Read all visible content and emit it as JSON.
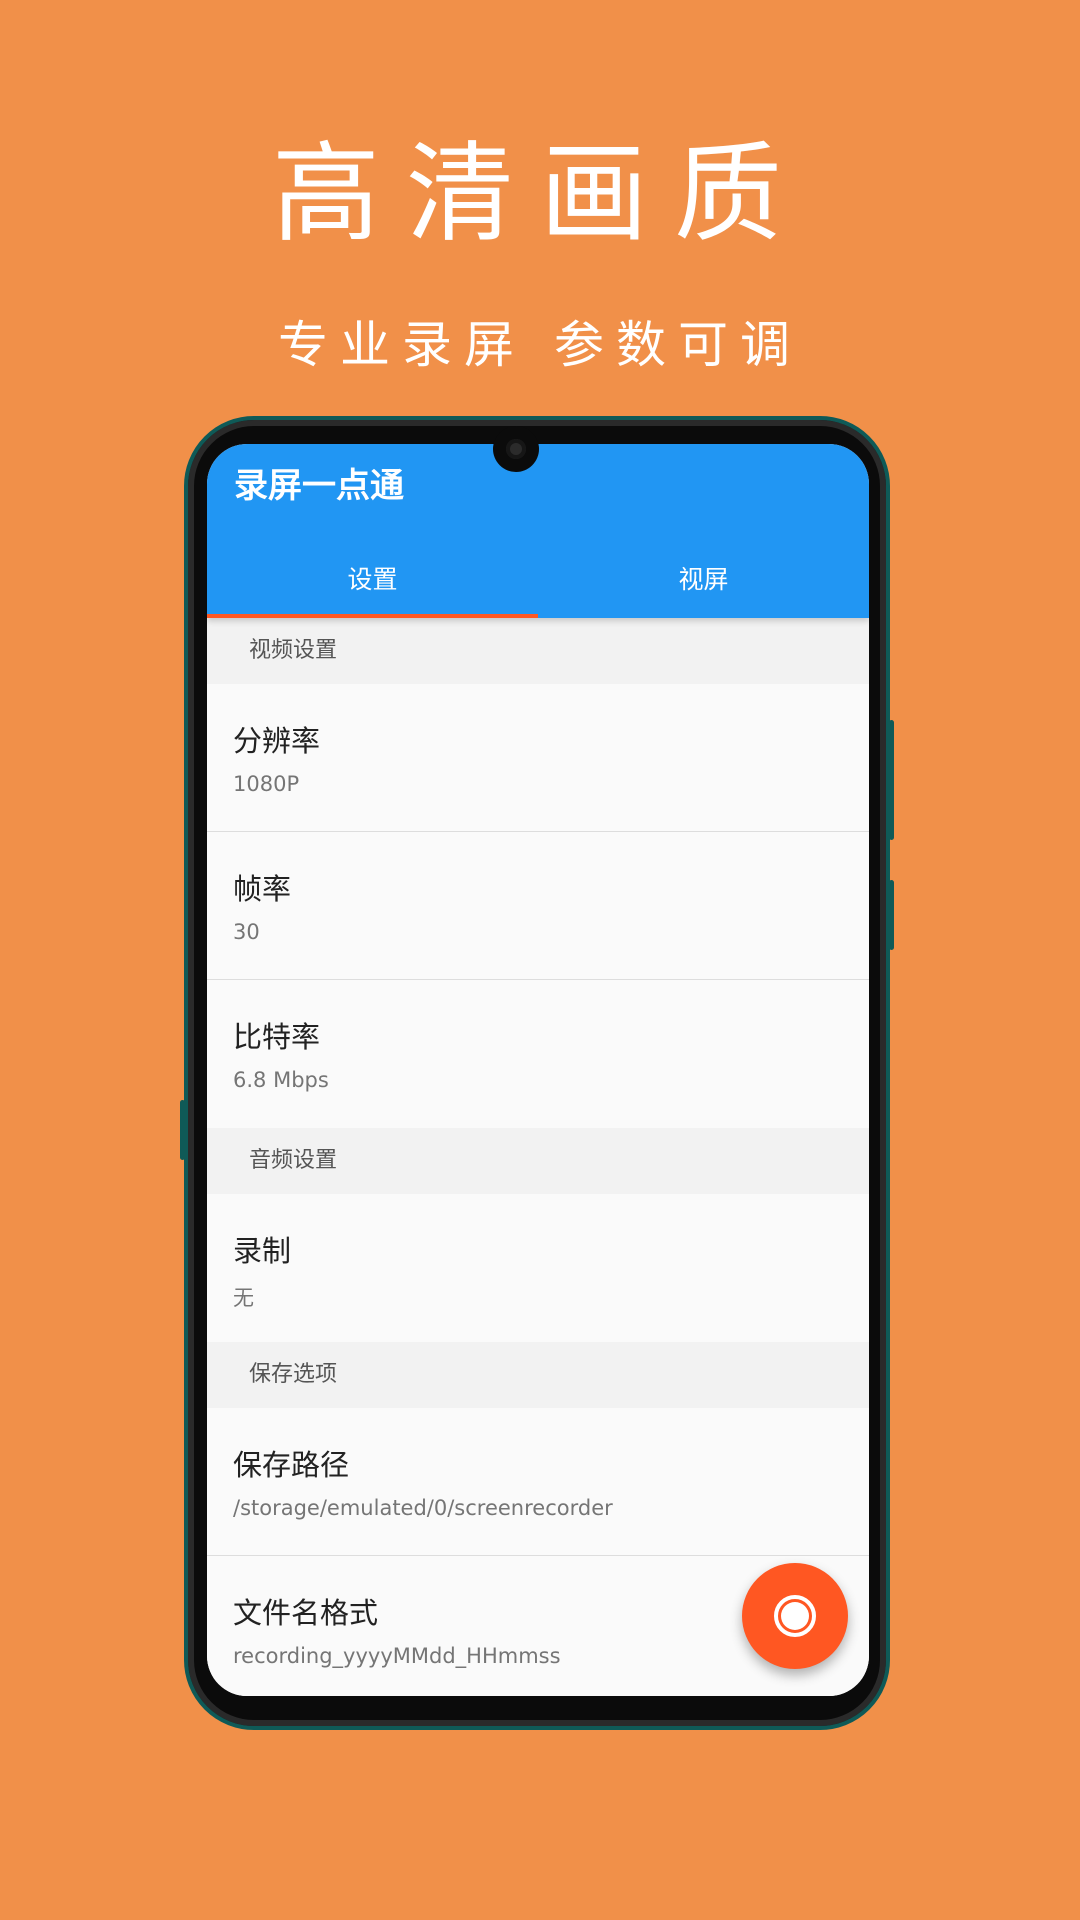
{
  "promo": {
    "title": "高清画质",
    "subtitle": "专业录屏 参数可调"
  },
  "app": {
    "title": "录屏一点通",
    "tabs": [
      {
        "label": "设置",
        "active": true
      },
      {
        "label": "视屏",
        "active": false
      }
    ]
  },
  "colors": {
    "background": "#F19049",
    "appbar": "#2196F3",
    "accent": "#FF5722"
  },
  "sections": {
    "video": {
      "header": "视频设置",
      "items": [
        {
          "title": "分辨率",
          "value": "1080P"
        },
        {
          "title": "帧率",
          "value": "30"
        },
        {
          "title": "比特率",
          "value": "6.8 Mbps"
        }
      ]
    },
    "audio": {
      "header": "音频设置",
      "items": [
        {
          "title": "录制",
          "value": "无"
        }
      ]
    },
    "save": {
      "header": "保存选项",
      "items": [
        {
          "title": "保存路径",
          "value": "/storage/emulated/0/screenrecorder"
        },
        {
          "title": "文件名格式",
          "value": "recording_yyyyMMdd_HHmmss"
        }
      ]
    }
  },
  "fab": {
    "icon": "record-icon"
  }
}
